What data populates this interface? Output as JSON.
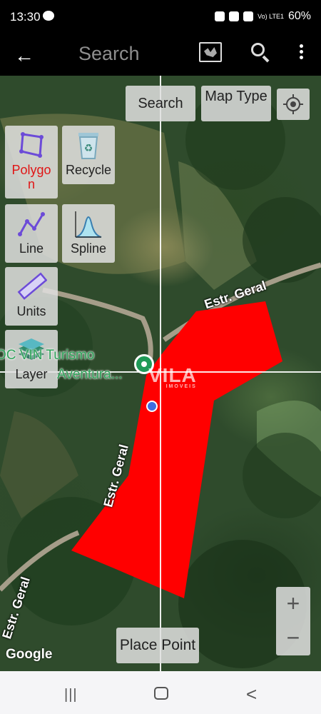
{
  "status_bar": {
    "time": "13:30",
    "battery": "60%",
    "network": "Vo) LTE1"
  },
  "app_bar": {
    "title": "Search",
    "back_icon": "arrow-back-icon",
    "map_type_icon": "map-picture-icon",
    "search_icon": "search-zoom-icon",
    "more_icon": "more-vert-icon"
  },
  "map_buttons": {
    "search": "Search",
    "map_type": "Map Type",
    "my_location_icon": "crosshair-target-icon"
  },
  "tools": [
    {
      "label": "Polygo n",
      "icon": "polygon-icon",
      "active": true
    },
    {
      "label": "Recycle",
      "icon": "recycle-bin-icon",
      "active": false
    },
    {
      "label": "Line",
      "icon": "polyline-icon",
      "active": false
    },
    {
      "label": "Spline",
      "icon": "bell-curve-icon",
      "active": false
    },
    {
      "label": "Units",
      "icon": "ruler-icon",
      "active": false
    },
    {
      "label": "Layer",
      "icon": "layers-icon",
      "active": false
    }
  ],
  "map": {
    "road_labels": [
      "Estr. Geral",
      "Estr. Geral",
      "Estr. Geral"
    ],
    "poi_label_line1": "OC VIN Turismo",
    "poi_label_line2": "Aventura...",
    "watermark": "VILA",
    "watermark_sub": "IMOVEIS",
    "google": "Google",
    "polygon_color": "#ff0000"
  },
  "zoom": {
    "in": "+",
    "out": "−"
  },
  "place_point": "Place Point",
  "nav_bar": {
    "recent": "|||",
    "home_icon": "home-icon",
    "back": "<"
  }
}
